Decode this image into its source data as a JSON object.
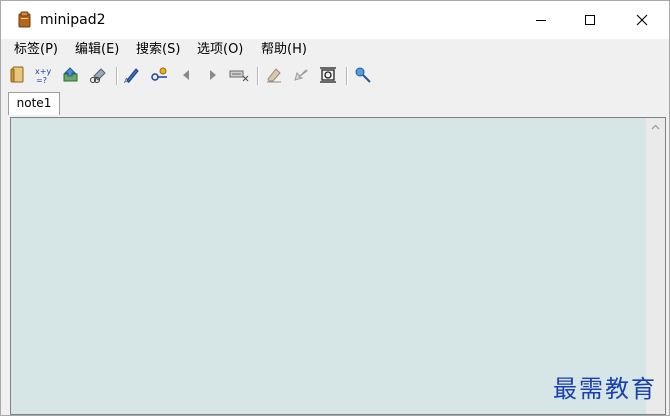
{
  "window": {
    "title": "minipad2"
  },
  "menu": {
    "items": [
      {
        "label": "标签(P)"
      },
      {
        "label": "编辑(E)"
      },
      {
        "label": "搜索(S)"
      },
      {
        "label": "选项(O)"
      },
      {
        "label": "帮助(H)"
      }
    ]
  },
  "toolbar": {
    "buttons": [
      {
        "icon": "new-note-icon"
      },
      {
        "icon": "calculator-icon"
      },
      {
        "icon": "insert-icon"
      },
      {
        "icon": "link-icon"
      },
      {
        "icon": "pen-icon"
      },
      {
        "icon": "key-icon"
      },
      {
        "icon": "arrow-left-icon"
      },
      {
        "icon": "arrow-right-icon"
      },
      {
        "icon": "keyboard-icon"
      },
      {
        "icon": "eraser-icon"
      },
      {
        "icon": "undo-icon"
      },
      {
        "icon": "clip-icon"
      },
      {
        "icon": "pin-icon"
      }
    ]
  },
  "tabs": [
    {
      "label": "note1"
    }
  ],
  "editor": {
    "content": ""
  },
  "watermark": {
    "text": "最需教育"
  }
}
